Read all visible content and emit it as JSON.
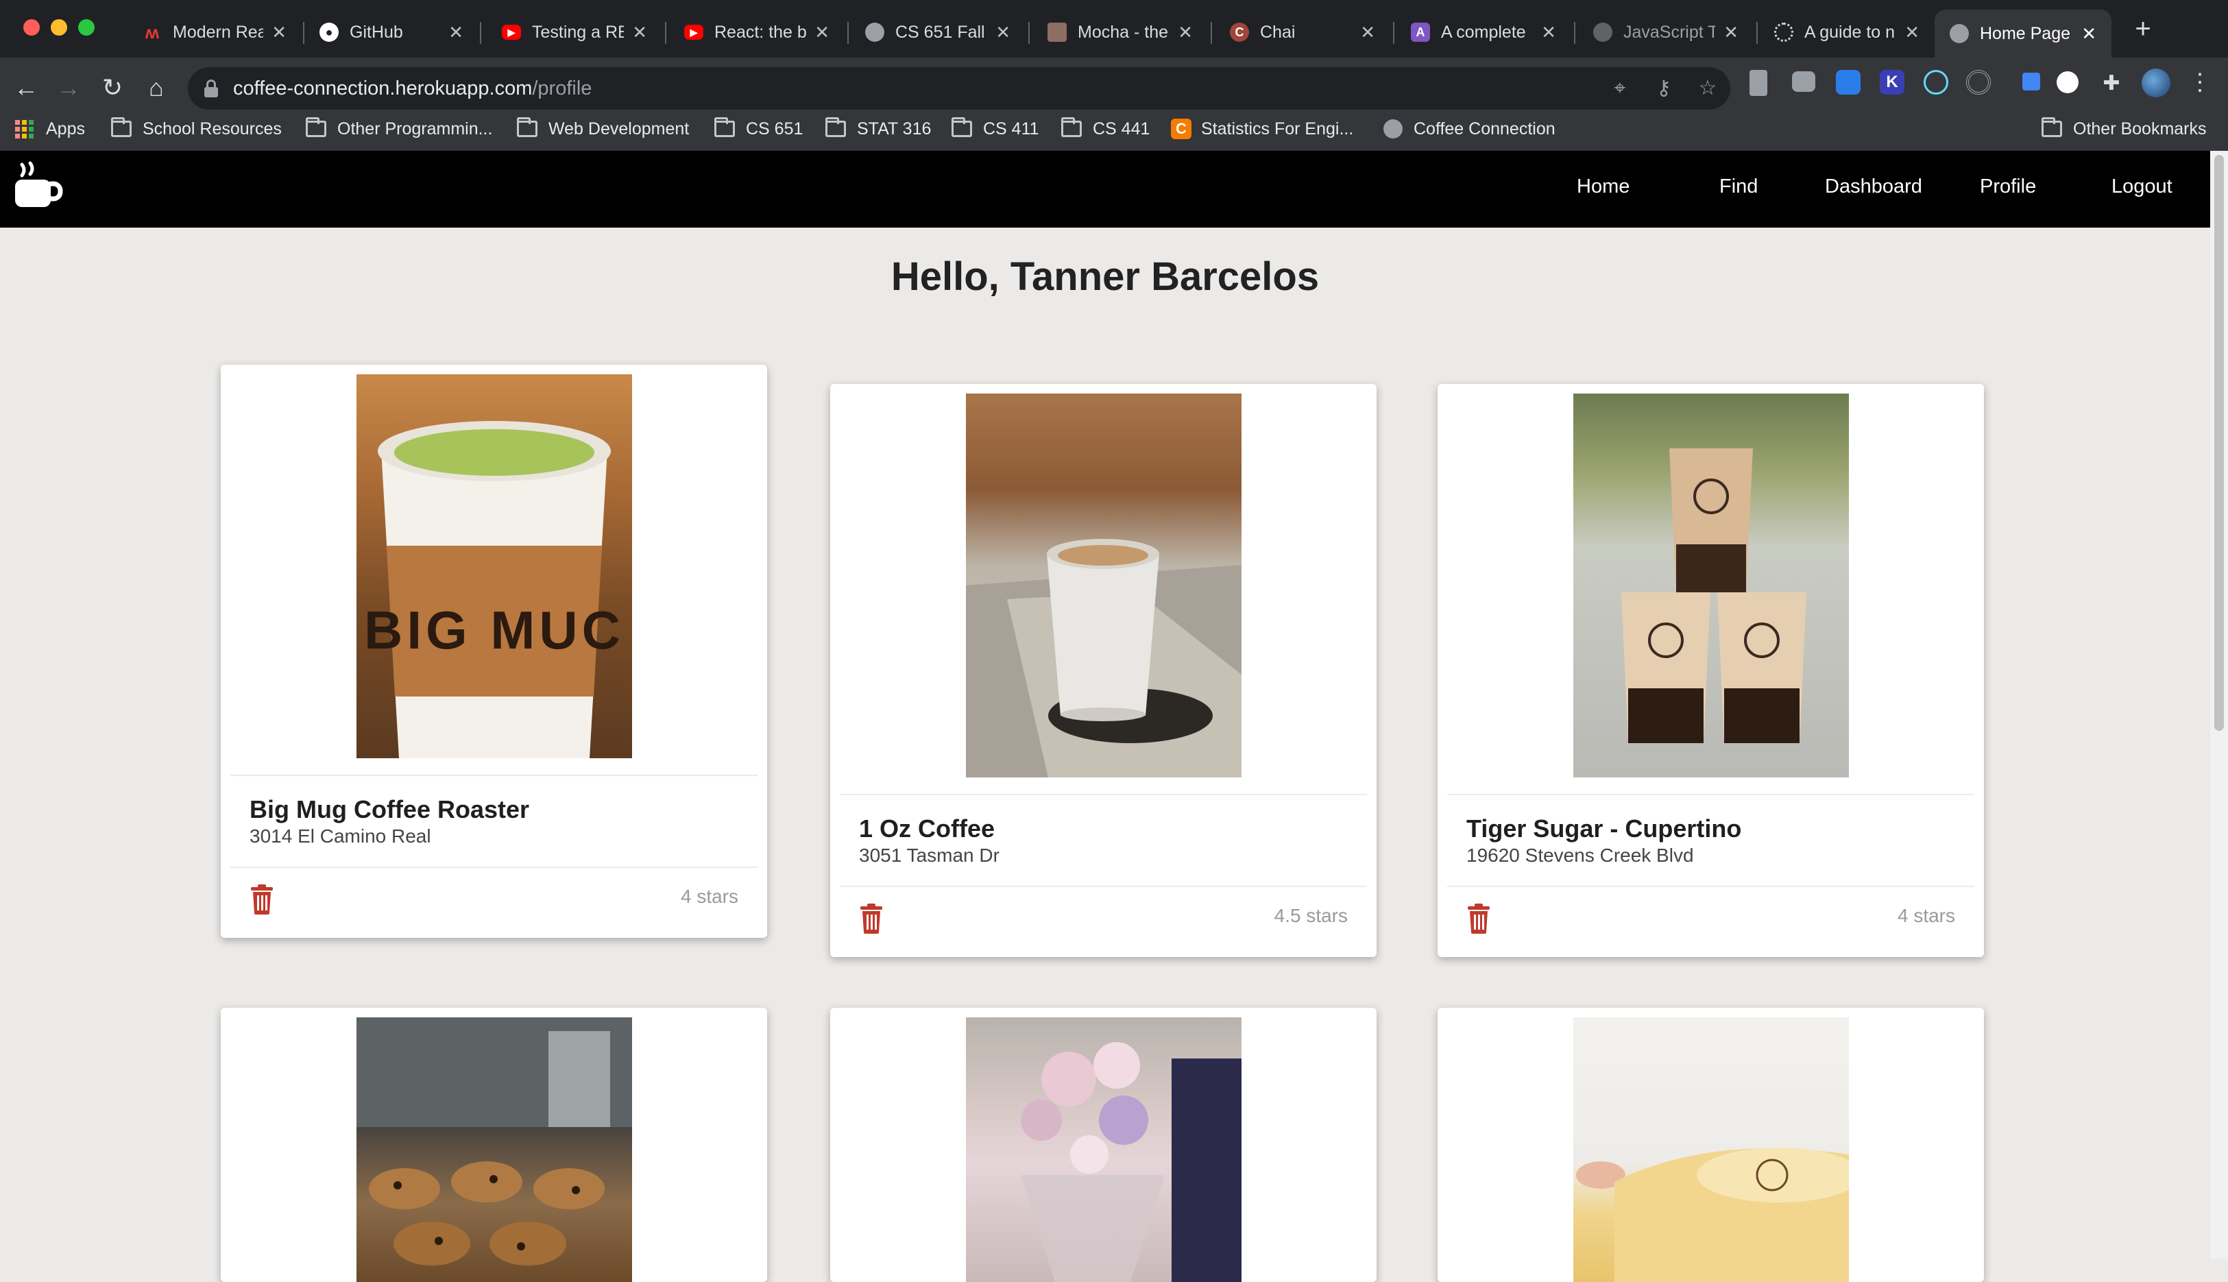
{
  "browser": {
    "tabs": [
      {
        "title": "Modern Rea",
        "icon": "react-course-icon",
        "color": "#e53935"
      },
      {
        "title": "GitHub",
        "icon": "github-icon",
        "color": "#ffffff"
      },
      {
        "title": "Testing a RE",
        "icon": "youtube-icon",
        "color": "#ff0000"
      },
      {
        "title": "React: the b",
        "icon": "youtube-icon",
        "color": "#ff0000"
      },
      {
        "title": "CS 651 Fall",
        "icon": "globe-icon",
        "color": "#9aa0a6"
      },
      {
        "title": "Mocha - the",
        "icon": "mocha-icon",
        "color": "#8d6e63"
      },
      {
        "title": "Chai",
        "icon": "chai-icon",
        "color": "#a1443c"
      },
      {
        "title": "A complete",
        "icon": "purple-icon",
        "color": "#7e57c2"
      },
      {
        "title": "JavaScript T",
        "icon": "globe-icon",
        "color": "#5f6368"
      },
      {
        "title": "A guide to n",
        "icon": "circle-icon",
        "color": "#cfd8dc"
      },
      {
        "title": "Home Page",
        "icon": "globe-icon",
        "color": "#9aa0a6"
      }
    ],
    "active_tab": 10,
    "url_host": "coffee-connection.herokuapp.com",
    "url_path": "/profile",
    "bookmarks": [
      {
        "label": "Apps",
        "kind": "apps"
      },
      {
        "label": "School Resources",
        "kind": "folder"
      },
      {
        "label": "Other Programmin...",
        "kind": "folder"
      },
      {
        "label": "Web Development",
        "kind": "folder"
      },
      {
        "label": "CS 651",
        "kind": "folder"
      },
      {
        "label": "STAT 316",
        "kind": "folder"
      },
      {
        "label": "CS 411",
        "kind": "folder"
      },
      {
        "label": "CS 441",
        "kind": "folder"
      },
      {
        "label": "Statistics For Engi...",
        "kind": "site"
      },
      {
        "label": "Coffee Connection",
        "kind": "globe"
      }
    ],
    "other_bookmarks": "Other Bookmarks"
  },
  "site": {
    "nav": [
      "Home",
      "Find",
      "Dashboard",
      "Profile",
      "Logout"
    ]
  },
  "page": {
    "greeting": "Hello, Tanner Barcelos",
    "cards": [
      {
        "name": "Big Mug Coffee Roaster",
        "address": "3014 El Camino Real",
        "stars": "4 stars",
        "photo": "matcha-latte-cup"
      },
      {
        "name": "1 Oz Coffee",
        "address": "3051 Tasman Dr",
        "stars": "4.5 stars",
        "photo": "latte-cup-on-stone"
      },
      {
        "name": "Tiger Sugar - Cupertino",
        "address": "19620 Stevens Creek Blvd",
        "stars": "4 stars",
        "photo": "boba-drinks"
      },
      {
        "name": "",
        "address": "",
        "stars": "",
        "photo": "cookies-tray"
      },
      {
        "name": "",
        "address": "",
        "stars": "",
        "photo": "flower-arrangement"
      },
      {
        "name": "",
        "address": "",
        "stars": "",
        "photo": "cheesecake"
      }
    ]
  },
  "colors": {
    "nav_bg": "#000000",
    "page_bg": "#eceae8",
    "trash": "#c0392b"
  }
}
